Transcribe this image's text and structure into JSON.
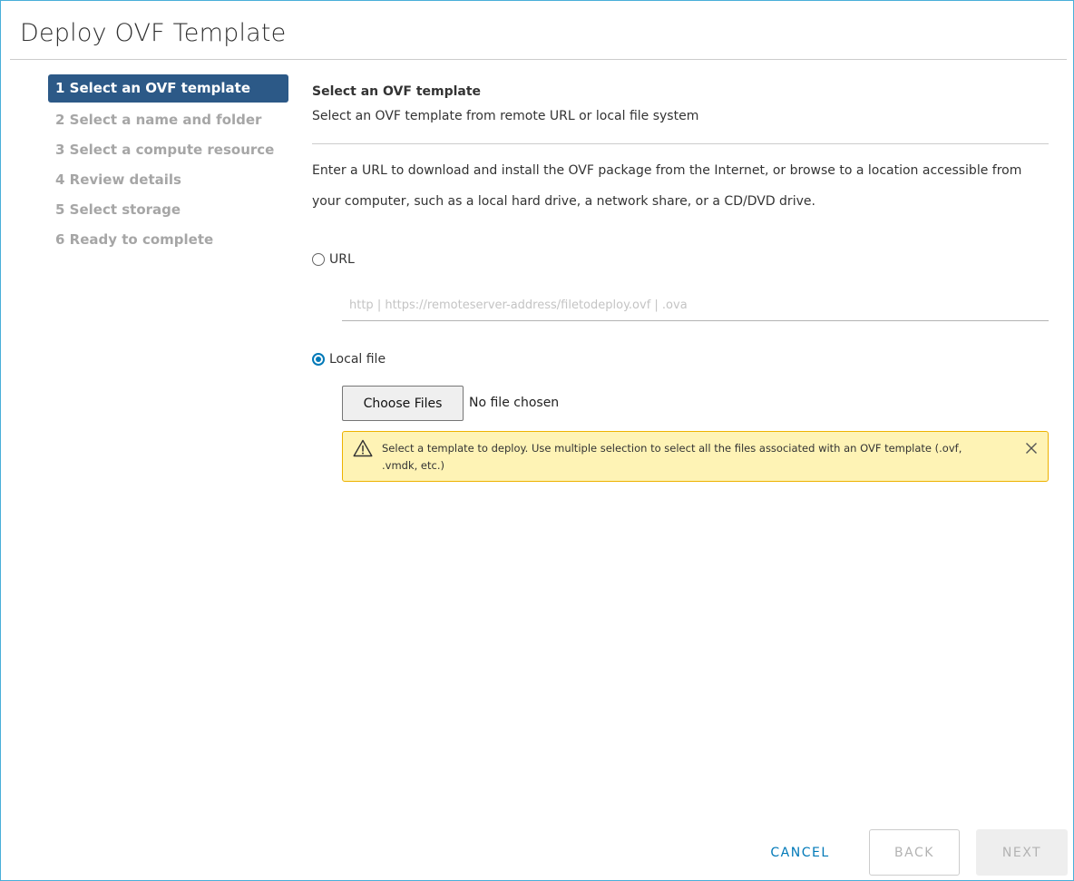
{
  "dialog": {
    "title": "Deploy OVF Template"
  },
  "steps": [
    {
      "label": "1 Select an OVF template",
      "active": true
    },
    {
      "label": "2 Select a name and folder",
      "active": false
    },
    {
      "label": "3 Select a compute resource",
      "active": false
    },
    {
      "label": "4 Review details",
      "active": false
    },
    {
      "label": "5 Select storage",
      "active": false
    },
    {
      "label": "6 Ready to complete",
      "active": false
    }
  ],
  "content": {
    "title": "Select an OVF template",
    "subtitle": "Select an OVF template from remote URL or local file system",
    "description": "Enter a URL to download and install the OVF package from the Internet, or browse to a location accessible from your computer, such as a local hard drive, a network share, or a CD/DVD drive.",
    "url_option": {
      "label": "URL",
      "selected": false,
      "placeholder": "http | https://remoteserver-address/filetodeploy.ovf | .ova",
      "value": ""
    },
    "local_option": {
      "label": "Local file",
      "selected": true,
      "choose_button": "Choose Files",
      "file_status": "No file chosen"
    },
    "alert": {
      "type": "warning",
      "text": "Select a template to deploy. Use multiple selection to select all the files associated with an OVF template (.ovf, .vmdk, etc.)"
    }
  },
  "footer": {
    "cancel_label": "CANCEL",
    "back_label": "BACK",
    "next_label": "NEXT"
  },
  "colors": {
    "accent": "#0079b8",
    "active_step_bg": "#2c5987",
    "dialog_border": "#49afd9",
    "alert_bg": "#fef3b5",
    "alert_border": "#edb200"
  }
}
